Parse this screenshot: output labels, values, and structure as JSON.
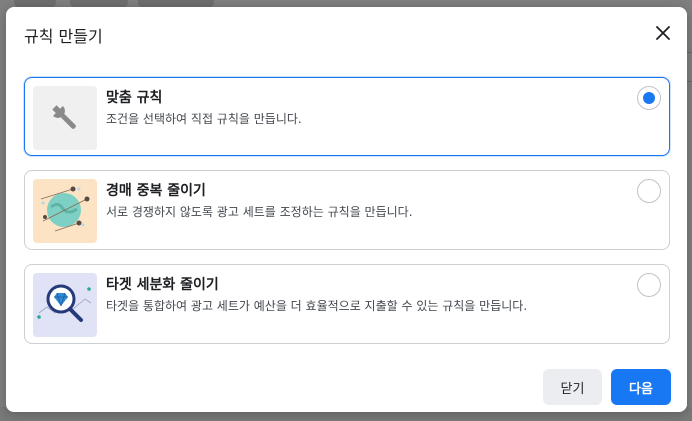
{
  "dialog": {
    "title": "규칙 만들기",
    "close_icon": "close-icon"
  },
  "options": [
    {
      "title": "맞춤 규칙",
      "description": "조건을 선택하여 직접 규칙을 만듭니다.",
      "icon": "wrench-icon",
      "selected": true
    },
    {
      "title": "경매 중복 줄이기",
      "description": "서로 경쟁하지 않도록 광고 세트를 조정하는 규칙을 만듭니다.",
      "icon": "globe-network-icon",
      "selected": false
    },
    {
      "title": "타겟 세분화 줄이기",
      "description": "타겟을 통합하여 광고 세트가 예산을 더 효율적으로 지출할 수 있는 규칙을 만듭니다.",
      "icon": "diamond-magnifier-icon",
      "selected": false
    }
  ],
  "footer": {
    "close_label": "닫기",
    "next_label": "다음"
  },
  "colors": {
    "accent": "#1877f2",
    "border": "#ccd0d5"
  }
}
